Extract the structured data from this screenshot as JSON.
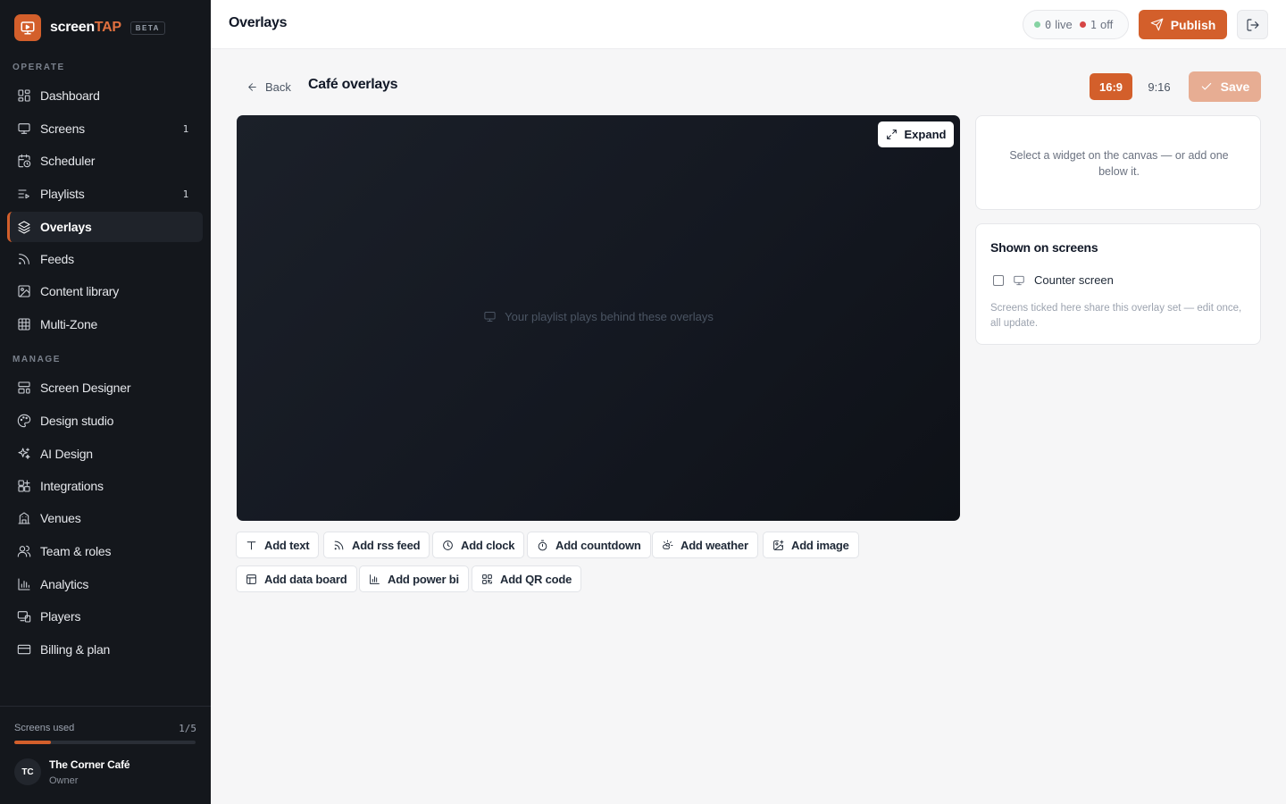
{
  "brand": {
    "name_main": "screen",
    "name_accent": "TAP",
    "badge": "BETA",
    "accent_color": "#d35f2b"
  },
  "sidebar": {
    "operate_label": "OPERATE",
    "manage_label": "MANAGE",
    "operate_items": [
      {
        "label": "Dashboard",
        "icon": "dashboard-icon",
        "count": ""
      },
      {
        "label": "Screens",
        "icon": "monitor-icon",
        "count": "1"
      },
      {
        "label": "Scheduler",
        "icon": "calendar-clock-icon",
        "count": ""
      },
      {
        "label": "Playlists",
        "icon": "playlist-icon",
        "count": "1"
      },
      {
        "label": "Overlays",
        "icon": "layers-icon",
        "count": "",
        "active": true
      },
      {
        "label": "Feeds",
        "icon": "rss-icon",
        "count": ""
      },
      {
        "label": "Content library",
        "icon": "image-icon",
        "count": ""
      },
      {
        "label": "Multi-Zone",
        "icon": "grid-icon",
        "count": ""
      }
    ],
    "manage_items": [
      {
        "label": "Screen Designer",
        "icon": "layout-icon"
      },
      {
        "label": "Design studio",
        "icon": "palette-icon"
      },
      {
        "label": "AI Design",
        "icon": "sparkles-icon"
      },
      {
        "label": "Integrations",
        "icon": "puzzle-icon"
      },
      {
        "label": "Venues",
        "icon": "building-icon"
      },
      {
        "label": "Team & roles",
        "icon": "users-icon"
      },
      {
        "label": "Analytics",
        "icon": "bar-chart-icon"
      },
      {
        "label": "Players",
        "icon": "player-device-icon"
      },
      {
        "label": "Billing & plan",
        "icon": "credit-card-icon"
      }
    ],
    "usage": {
      "label": "Screens used",
      "count": "1/5",
      "fraction": 0.2
    },
    "org": {
      "initials": "TC",
      "name": "The Corner Café",
      "role": "Owner"
    }
  },
  "topbar": {
    "title": "Overlays",
    "status": {
      "live_count": "0",
      "live_label": "live",
      "off_count": "1",
      "off_label": "off",
      "live_color": "#86d3a3",
      "off_color": "#d64545"
    },
    "publish_label": "Publish"
  },
  "editor": {
    "back_label": "Back",
    "title": "Café overlays",
    "ratio_a": "16:9",
    "ratio_b": "9:16",
    "save_label": "Save",
    "expand_label": "Expand",
    "canvas_hint": "Your playlist plays behind these overlays",
    "add_buttons": [
      {
        "label": "Add text",
        "icon": "text-icon"
      },
      {
        "label": "Add rss feed",
        "icon": "rss-icon"
      },
      {
        "label": "Add clock",
        "icon": "clock-icon"
      },
      {
        "label": "Add countdown",
        "icon": "timer-icon"
      },
      {
        "label": "Add weather",
        "icon": "weather-icon"
      },
      {
        "label": "Add image",
        "icon": "image-plus-icon"
      },
      {
        "label": "Add data board",
        "icon": "table-icon"
      },
      {
        "label": "Add power bi",
        "icon": "bar-chart-icon"
      },
      {
        "label": "Add QR code",
        "icon": "qr-code-icon"
      }
    ]
  },
  "inspector": {
    "hint": "Select a widget on the canvas — or add one below it."
  },
  "screens_panel": {
    "title": "Shown on screens",
    "screen_name": "Counter screen",
    "note": "Screens ticked here share this overlay set — edit once, all update."
  }
}
